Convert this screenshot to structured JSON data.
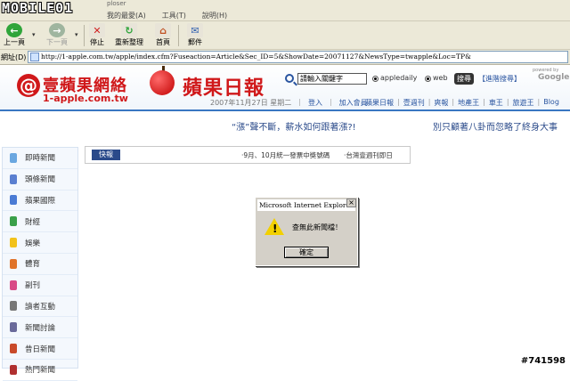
{
  "watermark": {
    "top_left": "MOBILE01",
    "bottom_right": "#741598"
  },
  "window_title_fragment": "ploser",
  "menu": [
    "我的最愛(A)",
    "工具(T)",
    "說明(H)"
  ],
  "toolbar": {
    "back": "上一頁",
    "forward": "下一頁",
    "stop": "停止",
    "refresh": "重新整理",
    "home": "首頁",
    "mail": "郵件"
  },
  "address": {
    "label": "網址(D)",
    "url": "http://1-apple.com.tw/apple/index.cfm?Fuseaction=Article&Sec_ID=5&ShowDate=20071127&NewsType=twapple&Loc=TP&"
  },
  "header": {
    "logo_zh": "壹蘋果網絡",
    "logo_en": "1-apple.com.tw",
    "daily_title": "蘋果日報",
    "search_placeholder": "請輸入關鍵字",
    "radio_appledaily": "appledaily",
    "radio_web": "web",
    "search_button": "搜尋",
    "advanced_search": "【進階搜尋】",
    "google_by": "powered by",
    "google": "Google",
    "date": "2007年11月27日 星期二",
    "login": "登入",
    "join": "加入會員",
    "nav": [
      "蘋果日報",
      "壹週刊",
      "爽報",
      "地產王",
      "車王",
      "旅遊王",
      "Blog"
    ]
  },
  "ticker": {
    "item1": "“漲”聲不斷，薪水如何跟著漲?!",
    "item2": "別只顧著八卦而忽略了終身大事"
  },
  "sidebar": {
    "items": [
      {
        "label": "即時新聞",
        "color": "#6aa7e0"
      },
      {
        "label": "頭條新聞",
        "color": "#5a7fd0"
      },
      {
        "label": "蘋果國際",
        "color": "#4a7bd4"
      },
      {
        "label": "財經",
        "color": "#3aa04a"
      },
      {
        "label": "娛樂",
        "color": "#f2c21a"
      },
      {
        "label": "體育",
        "color": "#e0742a"
      },
      {
        "label": "副刊",
        "color": "#d84a86"
      },
      {
        "label": "讀者互動",
        "color": "#777777"
      },
      {
        "label": "新聞討論",
        "color": "#6a6a9a"
      },
      {
        "label": "昔日新聞",
        "color": "#c94a2a"
      },
      {
        "label": "熱門新聞",
        "color": "#b03030"
      }
    ]
  },
  "flash": {
    "tag": "快報",
    "item1": "‧9月、10月統一發票中獎號碼",
    "item2": "‧台灣壹週刊即日"
  },
  "dialog": {
    "title": "Microsoft Internet Explorer",
    "close": "×",
    "message": "查無此新聞檔！",
    "ok": "確定"
  }
}
